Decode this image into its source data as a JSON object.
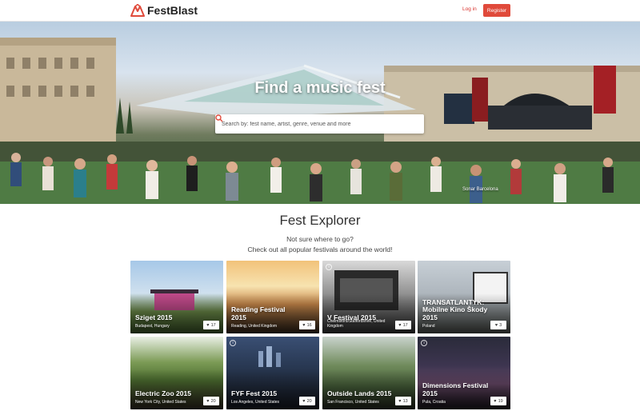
{
  "nav": {
    "brand": "FestBlast",
    "login": "Log in",
    "register": "Register"
  },
  "hero": {
    "title": "Find a music fest",
    "search_placeholder": "Search by: fest name, artist, genre, venue and more",
    "photo_credit": "Sonar Barcelona"
  },
  "explorer": {
    "title": "Fest Explorer",
    "subtitle_line1": "Not sure where to go?",
    "subtitle_line2": "Check out all popular festivals around the world!"
  },
  "festivals": [
    {
      "name": "Sziget 2015",
      "location": "Budapest, Hungary",
      "likes": "17"
    },
    {
      "name": "Reading Festival 2015",
      "location": "Reading, United Kingdom",
      "likes": "16"
    },
    {
      "name": "V Festival 2015",
      "location": "Chelmsford/Staffordshire, United Kingdom",
      "likes": "17"
    },
    {
      "name": "TRANSATLANTYK: Mobilne Kino Škody 2015",
      "location": "Poland",
      "likes": "3"
    },
    {
      "name": "Electric Zoo 2015",
      "location": "New York City, United States",
      "likes": "20"
    },
    {
      "name": "FYF Fest 2015",
      "location": "Los Angeles, United States",
      "likes": "20"
    },
    {
      "name": "Outside Lands 2015",
      "location": "San Francisco, United States",
      "likes": "13"
    },
    {
      "name": "Dimensions Festival 2015",
      "location": "Pula, Croatia",
      "likes": "19"
    }
  ],
  "colors": {
    "brand_red": "#e04a3b",
    "link_red": "#d9302a"
  }
}
